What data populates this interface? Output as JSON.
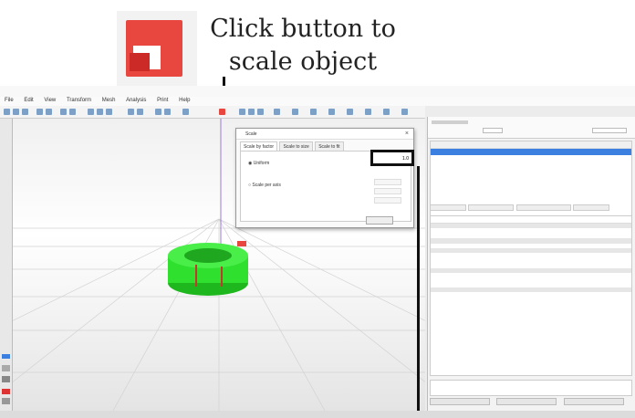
{
  "callout": {
    "text_line1": "Click button to",
    "text_line2": "scale object"
  },
  "app": {
    "title": "",
    "menu": [
      "File",
      "Edit",
      "View",
      "Transform",
      "Mesh",
      "Analysis",
      "Print",
      "Help"
    ]
  },
  "dialog": {
    "title": "Scale",
    "close": "×",
    "tabs": [
      "Scale by factor",
      "Scale to size",
      "Scale to fit"
    ],
    "options": [
      "Uniform",
      "Scale per axis"
    ],
    "value": "1.0"
  },
  "colors": {
    "object_green": "#2fe02f",
    "accent_red": "#e8473f",
    "selection_blue": "#3b7fe0"
  },
  "icons": [
    "scale-object-icon"
  ]
}
